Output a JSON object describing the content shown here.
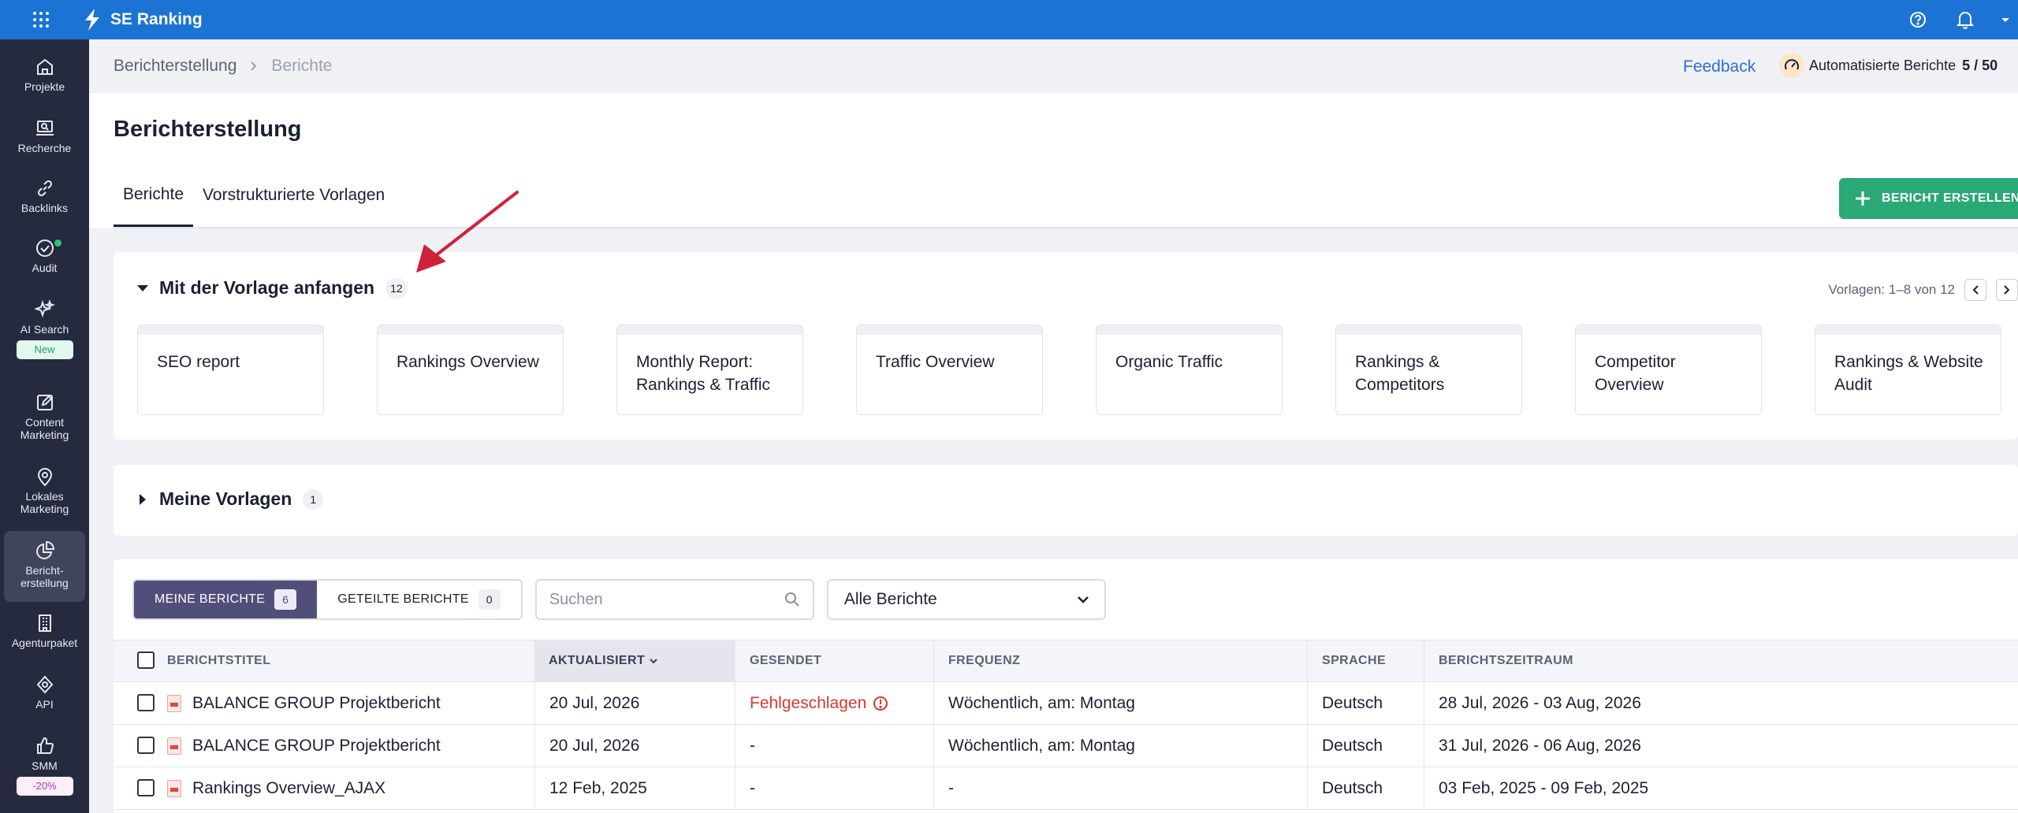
{
  "topbar": {
    "app_name": "SE Ranking",
    "icons": [
      "apps-grid-icon",
      "lightning-logo-icon",
      "help-icon",
      "bell-icon",
      "chevron-down-icon"
    ]
  },
  "sidebar": {
    "items": [
      {
        "label": "Projekte",
        "icon": "home-icon"
      },
      {
        "label": "Recherche",
        "icon": "laptop-search-icon"
      },
      {
        "label": "Backlinks",
        "icon": "link-icon"
      },
      {
        "label": "Audit",
        "icon": "check-circle-icon"
      },
      {
        "label": "AI Search",
        "icon": "sparkles-icon",
        "badge": "New"
      },
      {
        "label": "Content Marketing",
        "icon": "edit-icon"
      },
      {
        "label": "Lokales Marketing",
        "icon": "map-pin-icon"
      },
      {
        "label": "Bericht-erstellung",
        "icon": "pie-chart-icon",
        "active": true
      },
      {
        "label": "Agenturpaket",
        "icon": "building-icon"
      },
      {
        "label": "API",
        "icon": "api-icon"
      },
      {
        "label": "SMM",
        "icon": "thumbs-up-icon",
        "badge": "-20%"
      }
    ]
  },
  "breadcrumb": {
    "root": "Berichterstellung",
    "current": "Berichte"
  },
  "header": {
    "feedback": "Feedback",
    "quota_label": "Automatisierte Berichte",
    "quota_value": "5 / 50"
  },
  "page": {
    "title": "Berichterstellung",
    "tabs": [
      "Berichte",
      "Vorstrukturierte Vorlagen"
    ],
    "create_button": "BERICHT ERSTELLEN"
  },
  "templates": {
    "title": "Mit der Vorlage anfangen",
    "count": "12",
    "pager": "Vorlagen: 1–8 von 12",
    "cards": [
      "SEO report",
      "Rankings Overview",
      "Monthly Report: Rankings & Traffic",
      "Traffic Overview",
      "Organic Traffic",
      "Rankings & Competitors",
      "Competitor Overview",
      "Rankings & Website Audit"
    ]
  },
  "my_templates": {
    "title": "Meine Vorlagen",
    "count": "1"
  },
  "reports": {
    "tab_mine": "MEINE BERICHTE",
    "tab_mine_count": "6",
    "tab_shared": "GETEILTE BERICHTE",
    "tab_shared_count": "0",
    "search_placeholder": "Suchen",
    "filter_value": "Alle Berichte",
    "columns": [
      "BERICHTSTITEL",
      "AKTUALISIERT",
      "GESENDET",
      "FREQUENZ",
      "SPRACHE",
      "BERICHTSZEITRAUM"
    ],
    "rows": [
      {
        "title": "BALANCE GROUP Projektbericht",
        "updated": "20 Jul, 2026",
        "sent": "Fehlgeschlagen",
        "frequency": "Wöchentlich, am: Montag",
        "language": "Deutsch",
        "period": "28 Jul, 2026 - 03 Aug, 2026"
      },
      {
        "title": "BALANCE GROUP Projektbericht",
        "updated": "20 Jul, 2026",
        "sent": "-",
        "frequency": "Wöchentlich, am: Montag",
        "language": "Deutsch",
        "period": "31 Jul, 2026 - 06 Aug, 2026"
      },
      {
        "title": "Rankings Overview_AJAX",
        "updated": "12 Feb, 2025",
        "sent": "-",
        "frequency": "-",
        "language": "Deutsch",
        "period": "03 Feb, 2025 - 09 Feb, 2025"
      }
    ]
  },
  "colors": {
    "topbar": "#1b73d3",
    "sidebar": "#262a3e",
    "create_button": "#2aa876",
    "failed": "#d43a2f",
    "segment_active": "#514f7a",
    "annotation_arrow": "#d0213a"
  }
}
